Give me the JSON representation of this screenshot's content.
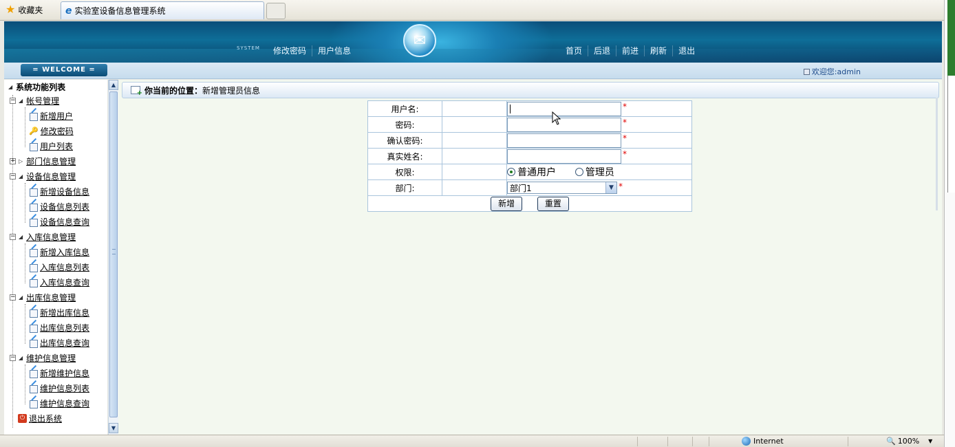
{
  "browser": {
    "favorites_label": "收藏夹",
    "tab_title": "实验室设备信息管理系统",
    "status_zone": "Internet",
    "zoom": "100%"
  },
  "header": {
    "system_tag": "SYSTEM",
    "left_nav": [
      "修改密码",
      "用户信息"
    ],
    "right_nav": [
      "首页",
      "后退",
      "前进",
      "刷新",
      "退出"
    ]
  },
  "welcome_bar": {
    "welcome_label": "= WELCOME =",
    "greeting": "欢迎您:admin"
  },
  "tree": {
    "root_label": "系统功能列表",
    "groups": [
      {
        "label": "帐号管理",
        "items": [
          "新增用户",
          "修改密码",
          "用户列表"
        ]
      },
      {
        "label": "部门信息管理",
        "items": []
      },
      {
        "label": "设备信息管理",
        "items": [
          "新增设备信息",
          "设备信息列表",
          "设备信息查询"
        ]
      },
      {
        "label": "入库信息管理",
        "items": [
          "新增入库信息",
          "入库信息列表",
          "入库信息查询"
        ]
      },
      {
        "label": "出库信息管理",
        "items": [
          "新增出库信息",
          "出库信息列表",
          "出库信息查询"
        ]
      },
      {
        "label": "维护信息管理",
        "items": [
          "新增维护信息",
          "维护信息列表",
          "维护信息查询"
        ]
      }
    ],
    "exit_label": "退出系统"
  },
  "main": {
    "crumb_prefix": "你当前的位置：",
    "crumb_page": "新增管理员信息",
    "form": {
      "username_label": "用户名:",
      "password_label": "密码:",
      "confirm_label": "确认密码:",
      "realname_label": "真实姓名:",
      "role_label": "权限:",
      "role_options": [
        "普通用户",
        "管理员"
      ],
      "role_selected": "普通用户",
      "dept_label": "部门:",
      "dept_value": "部门1",
      "required_mark": "*",
      "submit_label": "新增",
      "reset_label": "重置"
    }
  }
}
